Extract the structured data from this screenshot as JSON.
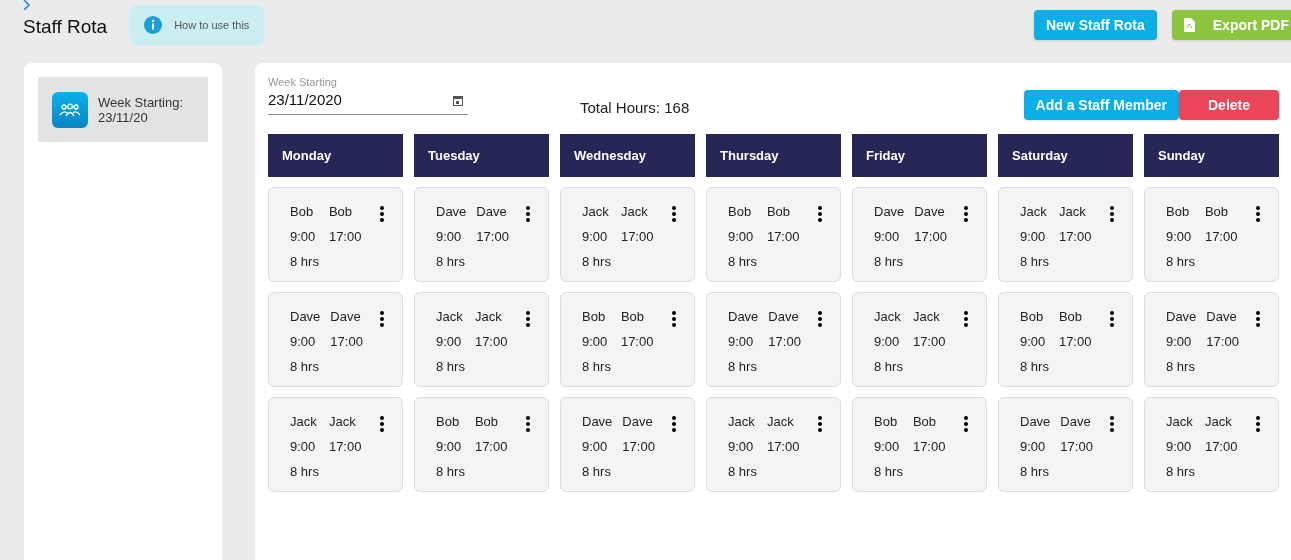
{
  "header": {
    "title": "Staff Rota",
    "help_button": "How to use this",
    "actions": [
      {
        "label": "New Staff Rota",
        "kind": "primary"
      },
      {
        "label": "Export PDF",
        "kind": "export"
      }
    ]
  },
  "sidebar": {
    "items": [
      {
        "label": "Week Starting:",
        "date": "23/11/20",
        "selected": true
      }
    ]
  },
  "toolbar": {
    "week_field": {
      "label": "Week Starting",
      "value": "23/11/2020"
    },
    "total_hours": "Total Hours: 168",
    "buttons": [
      {
        "label": "Add a Staff Member",
        "kind": "primary"
      },
      {
        "label": "Delete",
        "kind": "danger"
      }
    ]
  },
  "days": [
    {
      "name": "Monday",
      "shifts": [
        {
          "name_start": "Bob",
          "name_end": "Bob",
          "start": "9:00",
          "end": "17:00",
          "hours": "8 hrs"
        },
        {
          "name_start": "Dave",
          "name_end": "Dave",
          "start": "9:00",
          "end": "17:00",
          "hours": "8 hrs"
        },
        {
          "name_start": "Jack",
          "name_end": "Jack",
          "start": "9:00",
          "end": "17:00",
          "hours": "8 hrs"
        }
      ]
    },
    {
      "name": "Tuesday",
      "shifts": [
        {
          "name_start": "Dave",
          "name_end": "Dave",
          "start": "9:00",
          "end": "17:00",
          "hours": "8 hrs"
        },
        {
          "name_start": "Jack",
          "name_end": "Jack",
          "start": "9:00",
          "end": "17:00",
          "hours": "8 hrs"
        },
        {
          "name_start": "Bob",
          "name_end": "Bob",
          "start": "9:00",
          "end": "17:00",
          "hours": "8 hrs"
        }
      ]
    },
    {
      "name": "Wednesday",
      "shifts": [
        {
          "name_start": "Jack",
          "name_end": "Jack",
          "start": "9:00",
          "end": "17:00",
          "hours": "8 hrs"
        },
        {
          "name_start": "Bob",
          "name_end": "Bob",
          "start": "9:00",
          "end": "17:00",
          "hours": "8 hrs"
        },
        {
          "name_start": "Dave",
          "name_end": "Dave",
          "start": "9:00",
          "end": "17:00",
          "hours": "8 hrs"
        }
      ]
    },
    {
      "name": "Thursday",
      "shifts": [
        {
          "name_start": "Bob",
          "name_end": "Bob",
          "start": "9:00",
          "end": "17:00",
          "hours": "8 hrs"
        },
        {
          "name_start": "Dave",
          "name_end": "Dave",
          "start": "9:00",
          "end": "17:00",
          "hours": "8 hrs"
        },
        {
          "name_start": "Jack",
          "name_end": "Jack",
          "start": "9:00",
          "end": "17:00",
          "hours": "8 hrs"
        }
      ]
    },
    {
      "name": "Friday",
      "shifts": [
        {
          "name_start": "Dave",
          "name_end": "Dave",
          "start": "9:00",
          "end": "17:00",
          "hours": "8 hrs"
        },
        {
          "name_start": "Jack",
          "name_end": "Jack",
          "start": "9:00",
          "end": "17:00",
          "hours": "8 hrs"
        },
        {
          "name_start": "Bob",
          "name_end": "Bob",
          "start": "9:00",
          "end": "17:00",
          "hours": "8 hrs"
        }
      ]
    },
    {
      "name": "Saturday",
      "shifts": [
        {
          "name_start": "Jack",
          "name_end": "Jack",
          "start": "9:00",
          "end": "17:00",
          "hours": "8 hrs"
        },
        {
          "name_start": "Bob",
          "name_end": "Bob",
          "start": "9:00",
          "end": "17:00",
          "hours": "8 hrs"
        },
        {
          "name_start": "Dave",
          "name_end": "Dave",
          "start": "9:00",
          "end": "17:00",
          "hours": "8 hrs"
        }
      ]
    },
    {
      "name": "Sunday",
      "shifts": [
        {
          "name_start": "Bob",
          "name_end": "Bob",
          "start": "9:00",
          "end": "17:00",
          "hours": "8 hrs"
        },
        {
          "name_start": "Dave",
          "name_end": "Dave",
          "start": "9:00",
          "end": "17:00",
          "hours": "8 hrs"
        },
        {
          "name_start": "Jack",
          "name_end": "Jack",
          "start": "9:00",
          "end": "17:00",
          "hours": "8 hrs"
        }
      ]
    }
  ]
}
